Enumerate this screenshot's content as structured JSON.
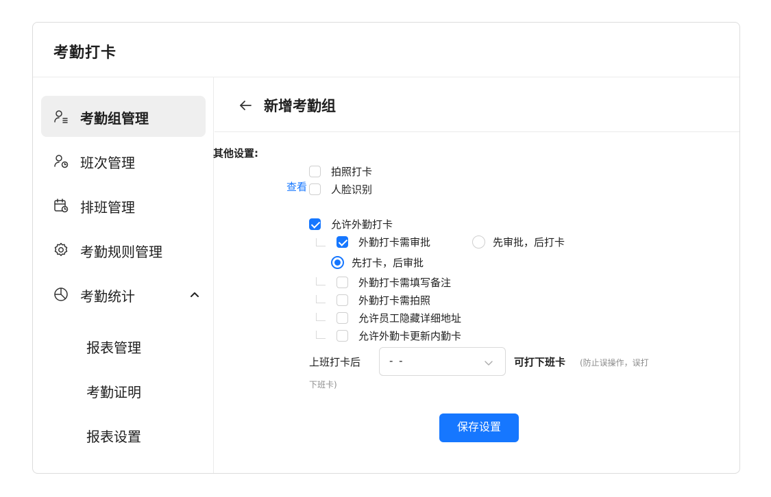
{
  "app": {
    "title": "考勤打卡"
  },
  "sidebar": {
    "items": [
      {
        "label": "考勤组管理",
        "icon": "user-group-icon",
        "active": true
      },
      {
        "label": "班次管理",
        "icon": "user-clock-icon"
      },
      {
        "label": "排班管理",
        "icon": "calendar-clock-icon"
      },
      {
        "label": "考勤规则管理",
        "icon": "gear-icon"
      },
      {
        "label": "考勤统计",
        "icon": "pie-chart-icon",
        "expanded": true
      }
    ],
    "sub_items": [
      {
        "label": "报表管理"
      },
      {
        "label": "考勤证明"
      },
      {
        "label": "报表设置"
      }
    ]
  },
  "content": {
    "title": "新增考勤组",
    "form": {
      "other_settings_label": "其他设置:",
      "photo_checkin": {
        "label": "拍照打卡",
        "checked": false
      },
      "face_recognition": {
        "label": "人脸识别",
        "checked": false
      },
      "view_link": "查看",
      "allow_field_checkin": {
        "label": "允许外勤打卡",
        "checked": true
      },
      "field_need_approval": {
        "label": "外勤打卡需审批",
        "checked": true
      },
      "approve_first": {
        "label": "先审批，后打卡",
        "selected": false
      },
      "checkin_first": {
        "label": "先打卡，后审批",
        "selected": true
      },
      "field_need_note": {
        "label": "外勤打卡需填写备注",
        "checked": false
      },
      "field_need_photo": {
        "label": "外勤打卡需拍照",
        "checked": false
      },
      "hide_address": {
        "label": "允许员工隐藏详细地址",
        "checked": false
      },
      "update_inner": {
        "label": "允许外勤卡更新内勤卡",
        "checked": false
      },
      "after_checkin_label": "上班打卡后",
      "after_checkin_value": "- -",
      "can_checkout_label": "可打下班卡",
      "hint_line1": "(防止误操作，误打",
      "hint_line2": "下班卡)",
      "save_label": "保存设置"
    }
  },
  "colors": {
    "accent": "#1677ff",
    "active_bg": "#efefef",
    "border": "#dcdcdc"
  }
}
